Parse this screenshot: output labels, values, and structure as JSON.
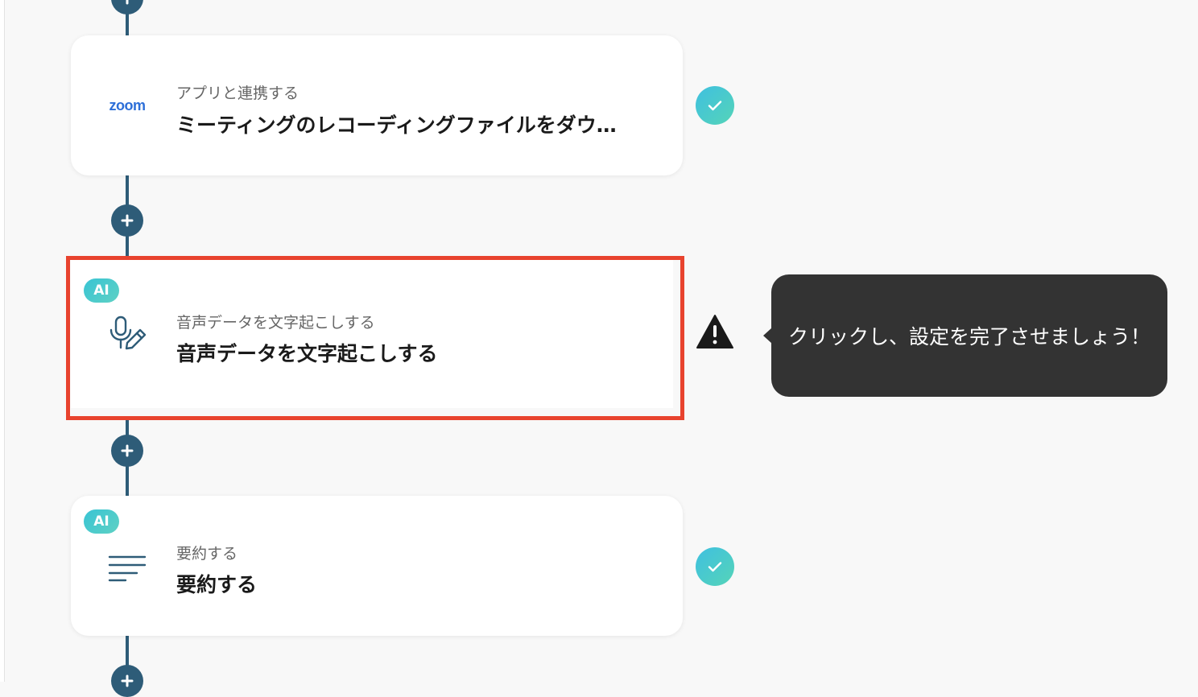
{
  "flow": {
    "steps": [
      {
        "id": "zoom",
        "subtitle": "アプリと連携する",
        "title": "ミーティングのレコーディングファイルをダウンロード",
        "icon": "zoom-logo",
        "logo_text": "zoom",
        "ai": false,
        "status": "complete"
      },
      {
        "id": "transcribe",
        "subtitle": "音声データを文字起こしする",
        "title": "音声データを文字起こしする",
        "icon": "microphone-pen-icon",
        "ai": true,
        "ai_label": "AI",
        "status": "warning",
        "highlighted": true
      },
      {
        "id": "summarize",
        "subtitle": "要約する",
        "title": "要約する",
        "icon": "text-lines-icon",
        "ai": true,
        "ai_label": "AI",
        "status": "complete"
      }
    ]
  },
  "tooltip": {
    "text": "クリックし、設定を完了させましょう！"
  },
  "colors": {
    "connector": "#2e5c78",
    "highlight_border": "#e8432e",
    "check_gradient_start": "#3fc0e0",
    "check_gradient_end": "#55d4b8",
    "tooltip_bg": "#333333",
    "zoom_blue": "#2d6fd8"
  }
}
